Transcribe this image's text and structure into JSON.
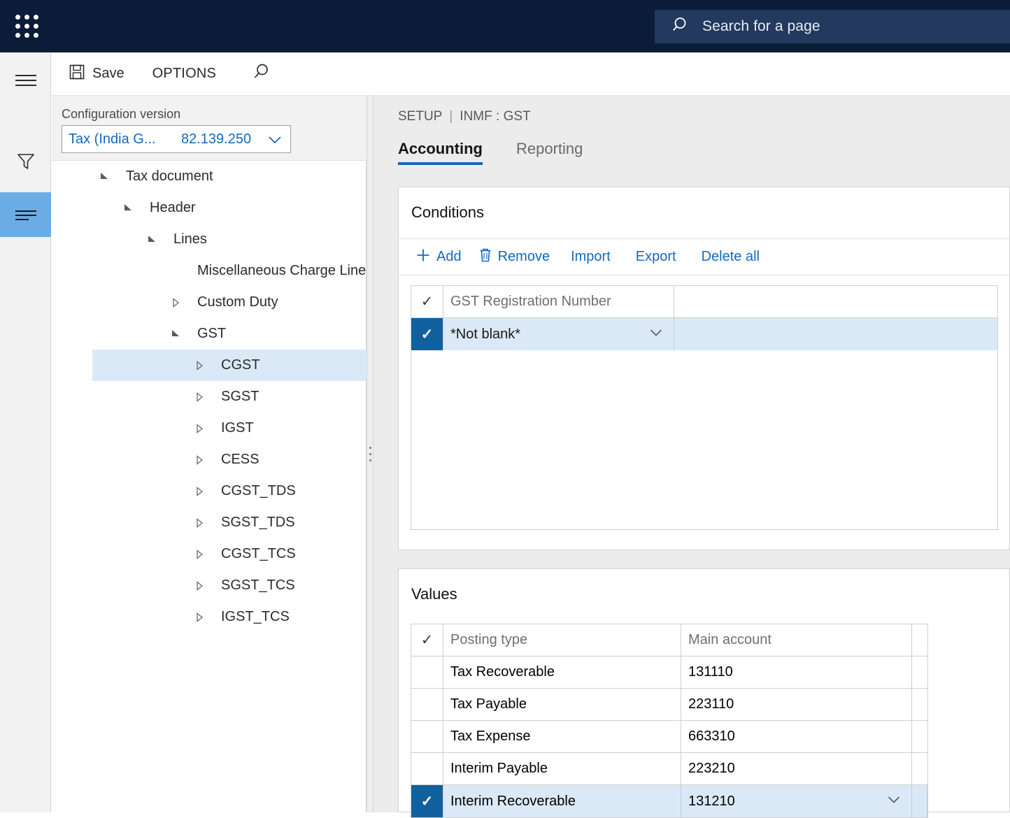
{
  "topbar": {
    "waffle_icon": "app-launcher-icon",
    "search": {
      "icon": "search-icon",
      "placeholder": "Search for a page",
      "value": "Search for a page"
    }
  },
  "rail": {
    "items": [
      {
        "name": "hamburger-icon",
        "label": "Menu",
        "selected": false
      },
      {
        "name": "filter-icon",
        "label": "Filter",
        "selected": false
      },
      {
        "name": "list-icon",
        "label": "Navigation list",
        "selected": true
      }
    ]
  },
  "commandbar": {
    "save_label": "Save",
    "save_icon": "save-disk-icon",
    "options_label": "OPTIONS",
    "search_icon": "search-icon"
  },
  "left_pane": {
    "config_label": "Configuration version",
    "config_value": "Tax (India G...",
    "config_version": "82.139.250",
    "chevron_icon": "chevron-down-icon",
    "tree": [
      {
        "label": "Tax document",
        "indent": 0,
        "twisty": "expanded",
        "selected": false
      },
      {
        "label": "Header",
        "indent": 1,
        "twisty": "expanded",
        "selected": false
      },
      {
        "label": "Lines",
        "indent": 2,
        "twisty": "expanded",
        "selected": false
      },
      {
        "label": "Miscellaneous Charge Line",
        "indent": 3,
        "twisty": "none",
        "selected": false
      },
      {
        "label": "Custom Duty",
        "indent": 3,
        "twisty": "collapsed",
        "selected": false
      },
      {
        "label": "GST",
        "indent": 3,
        "twisty": "expanded",
        "selected": false
      },
      {
        "label": "CGST",
        "indent": 4,
        "twisty": "collapsed",
        "selected": true
      },
      {
        "label": "SGST",
        "indent": 4,
        "twisty": "collapsed",
        "selected": false
      },
      {
        "label": "IGST",
        "indent": 4,
        "twisty": "collapsed",
        "selected": false
      },
      {
        "label": "CESS",
        "indent": 4,
        "twisty": "collapsed",
        "selected": false
      },
      {
        "label": "CGST_TDS",
        "indent": 4,
        "twisty": "collapsed",
        "selected": false
      },
      {
        "label": "SGST_TDS",
        "indent": 4,
        "twisty": "collapsed",
        "selected": false
      },
      {
        "label": "CGST_TCS",
        "indent": 4,
        "twisty": "collapsed",
        "selected": false
      },
      {
        "label": "SGST_TCS",
        "indent": 4,
        "twisty": "collapsed",
        "selected": false
      },
      {
        "label": "IGST_TCS",
        "indent": 4,
        "twisty": "collapsed",
        "selected": false
      }
    ]
  },
  "splitter": {
    "icon": "drag-handle-icon"
  },
  "right_pane": {
    "breadcrumb_setup": "SETUP",
    "breadcrumb_sep": "|",
    "breadcrumb_page": "INMF : GST",
    "tabs": [
      {
        "label": "Accounting",
        "active": true
      },
      {
        "label": "Reporting",
        "active": false
      }
    ],
    "conditions": {
      "title": "Conditions",
      "toolbar": [
        {
          "label": "Add",
          "icon": "plus-icon"
        },
        {
          "label": "Remove",
          "icon": "trash-icon"
        },
        {
          "label": "Import",
          "icon": "none"
        },
        {
          "label": "Export",
          "icon": "none"
        },
        {
          "label": "Delete all",
          "icon": "none"
        }
      ],
      "columns": [
        "GST Registration Number"
      ],
      "header_check_icon": "checkmark-icon",
      "rows": [
        {
          "checked": true,
          "selected": true,
          "value": "*Not blank*",
          "chevron_icon": "chevron-down-icon"
        }
      ]
    },
    "values": {
      "title": "Values",
      "header_check_icon": "checkmark-icon",
      "columns": [
        "Posting type",
        "Main account",
        ""
      ],
      "rows": [
        {
          "checked": false,
          "selected": false,
          "posting_type": "Tax Recoverable",
          "main_account": "131110"
        },
        {
          "checked": false,
          "selected": false,
          "posting_type": "Tax Payable",
          "main_account": "223110"
        },
        {
          "checked": false,
          "selected": false,
          "posting_type": "Tax Expense",
          "main_account": "663310"
        },
        {
          "checked": false,
          "selected": false,
          "posting_type": "Interim Payable",
          "main_account": "223210"
        },
        {
          "checked": true,
          "selected": true,
          "posting_type": "Interim Recoverable",
          "main_account": "131210",
          "chevron_icon": "chevron-down-icon"
        }
      ]
    }
  },
  "colors": {
    "topbar_bg": "#0b1c38",
    "search_bg": "#233a5e",
    "accent_link": "#1568bf",
    "tab_underline": "#1565c0",
    "row_selected_bg": "#dbe9f7",
    "check_cell_bg": "#10619e",
    "rail_selected_bg": "#6cace4",
    "content_bg": "#ececec"
  }
}
